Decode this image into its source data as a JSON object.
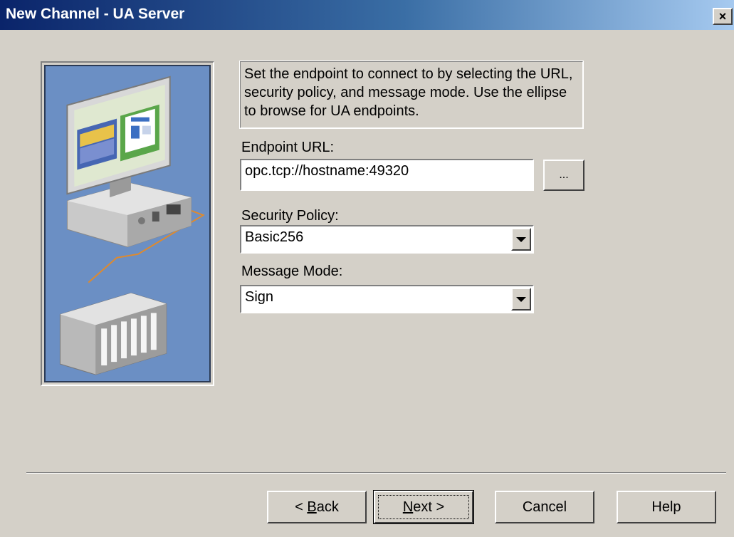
{
  "window": {
    "title": "New Channel - UA Server",
    "close_symbol": "×"
  },
  "description": "Set the endpoint to connect to by selecting the URL, security policy, and message mode. Use the ellipse to browse for UA endpoints.",
  "endpoint": {
    "label": "Endpoint URL:",
    "value": "opc.tcp://hostname:49320",
    "browse_label": "..."
  },
  "security_policy": {
    "label": "Security Policy:",
    "value": "Basic256"
  },
  "message_mode": {
    "label": "Message Mode:",
    "value": "Sign"
  },
  "buttons": {
    "back_prefix": "< ",
    "back_accel": "B",
    "back_rest": "ack",
    "next_accel": "N",
    "next_rest": "ext >",
    "cancel": "Cancel",
    "help": "Help"
  },
  "icons": {
    "illustration": "computer-network-plc-illustration",
    "close": "close-icon",
    "dropdown": "chevron-down-icon"
  }
}
